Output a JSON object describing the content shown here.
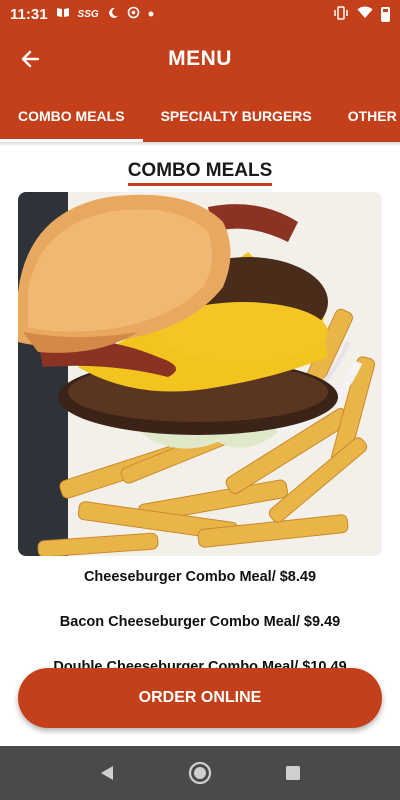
{
  "status_bar": {
    "time": "11:31",
    "icons_left": [
      "book-icon",
      "ssg-icon",
      "moon-icon",
      "swirl-icon",
      "dot-icon"
    ],
    "icons_right": [
      "vibrate-icon",
      "wifi-icon",
      "battery-icon"
    ]
  },
  "app_bar": {
    "title": "MENU"
  },
  "tabs": [
    {
      "label": "COMBO MEALS",
      "active": true
    },
    {
      "label": "SPECIALTY BURGERS",
      "active": false
    },
    {
      "label": "OTHER",
      "active": false
    }
  ],
  "section": {
    "title": "COMBO MEALS"
  },
  "menu_items": [
    "Cheeseburger Combo Meal/ $8.49",
    "Bacon Cheeseburger Combo Meal/ $9.49",
    "Double Cheeseburger Combo Meal/ $10.49"
  ],
  "order_button": {
    "label": "ORDER ONLINE"
  },
  "colors": {
    "primary": "#c4401a",
    "nav_bar": "#4a4a4a"
  }
}
